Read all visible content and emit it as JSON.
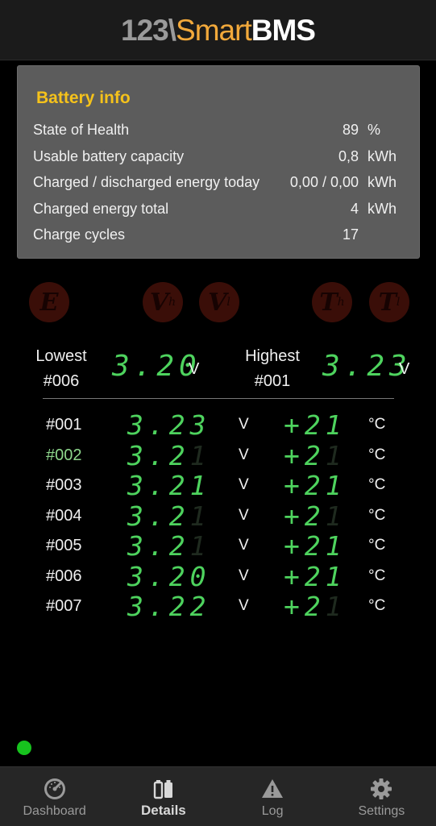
{
  "header": {
    "logo_part1": "123\\",
    "logo_part2": "Smart",
    "logo_part3": "BMS"
  },
  "battery_info": {
    "title": "Battery info",
    "rows": [
      {
        "label": "State of Health",
        "value": "89",
        "unit": "%"
      },
      {
        "label": "Usable battery capacity",
        "value": "0,8",
        "unit": "kWh"
      },
      {
        "label": "Charged / discharged energy today",
        "value": "0,00 / 0,00",
        "unit": "kWh"
      },
      {
        "label": "Charged energy total",
        "value": "4",
        "unit": "kWh"
      },
      {
        "label": "Charge cycles",
        "value": "17",
        "unit": ""
      }
    ]
  },
  "indicators": [
    {
      "letter": "E",
      "sub": ""
    },
    {
      "letter": "V",
      "sub": "h"
    },
    {
      "letter": "V",
      "sub": "l"
    },
    {
      "letter": "T",
      "sub": "h"
    },
    {
      "letter": "T",
      "sub": "l"
    }
  ],
  "summary": {
    "lowest": {
      "label": "Lowest",
      "cell": "#006",
      "value": "3.20",
      "unit": "V"
    },
    "highest": {
      "label": "Highest",
      "cell": "#001",
      "value": "3.23",
      "unit": "V"
    }
  },
  "cells": [
    {
      "id": "#001",
      "volt_lit": "3.23",
      "volt_dim": "",
      "temp_lit": "+21",
      "temp_dim": "",
      "volt_unit": "V",
      "temp_unit": "°C"
    },
    {
      "id": "#002",
      "volt_lit": "3.2",
      "volt_dim": "1",
      "temp_lit": "+2",
      "temp_dim": "1",
      "volt_unit": "V",
      "temp_unit": "°C"
    },
    {
      "id": "#003",
      "volt_lit": "3.21",
      "volt_dim": "",
      "temp_lit": "+21",
      "temp_dim": "",
      "volt_unit": "V",
      "temp_unit": "°C"
    },
    {
      "id": "#004",
      "volt_lit": "3.2",
      "volt_dim": "1",
      "temp_lit": "+2",
      "temp_dim": "1",
      "volt_unit": "V",
      "temp_unit": "°C"
    },
    {
      "id": "#005",
      "volt_lit": "3.2",
      "volt_dim": "1",
      "temp_lit": "+21",
      "temp_dim": "",
      "volt_unit": "V",
      "temp_unit": "°C"
    },
    {
      "id": "#006",
      "volt_lit": "3.20",
      "volt_dim": "",
      "temp_lit": "+21",
      "temp_dim": "",
      "volt_unit": "V",
      "temp_unit": "°C"
    },
    {
      "id": "#007",
      "volt_lit": "3.22",
      "volt_dim": "",
      "temp_lit": "+2",
      "temp_dim": "1",
      "volt_unit": "V",
      "temp_unit": "°C"
    }
  ],
  "selected_cell": "#002",
  "status": {
    "connected_color": "#17c31e"
  },
  "nav": {
    "items": [
      {
        "label": "Dashboard",
        "icon": "gauge-icon"
      },
      {
        "label": "Details",
        "icon": "battery-cells-icon",
        "active": true
      },
      {
        "label": "Log",
        "icon": "warning-icon"
      },
      {
        "label": "Settings",
        "icon": "gear-icon"
      }
    ]
  },
  "colors": {
    "accent": "#f5c21b",
    "segment_on": "#4ed35e",
    "alarm_off": "#3a0e08"
  }
}
